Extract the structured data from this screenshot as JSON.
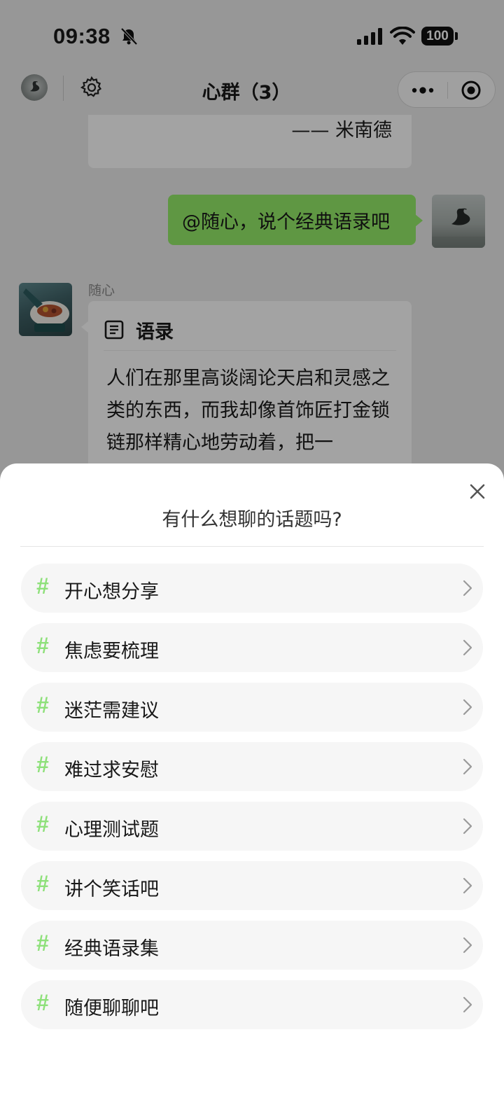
{
  "status_bar": {
    "time": "09:38",
    "battery": "100"
  },
  "nav": {
    "title": "心群（3）"
  },
  "chat": {
    "quote_author": "—— 米南德",
    "my_message": "@随心，说个经典语录吧",
    "bot_name": "随心",
    "card_title": "语录",
    "card_text": "人们在那里高谈阔论天启和灵感之类的东西，而我却像首饰匠打金锁链那样精心地劳动着，把一"
  },
  "sheet": {
    "title": "有什么想聊的话题吗?",
    "hash_symbol": "#",
    "topics": [
      {
        "label": "开心想分享"
      },
      {
        "label": "焦虑要梳理"
      },
      {
        "label": "迷茫需建议"
      },
      {
        "label": "难过求安慰"
      },
      {
        "label": "心理测试题"
      },
      {
        "label": "讲个笑话吧"
      },
      {
        "label": "经典语录集"
      },
      {
        "label": "随便聊聊吧"
      }
    ]
  },
  "colors": {
    "accent_green": "#95ec69",
    "hash_green": "#8ee07a",
    "sheet_bg": "#ffffff"
  }
}
